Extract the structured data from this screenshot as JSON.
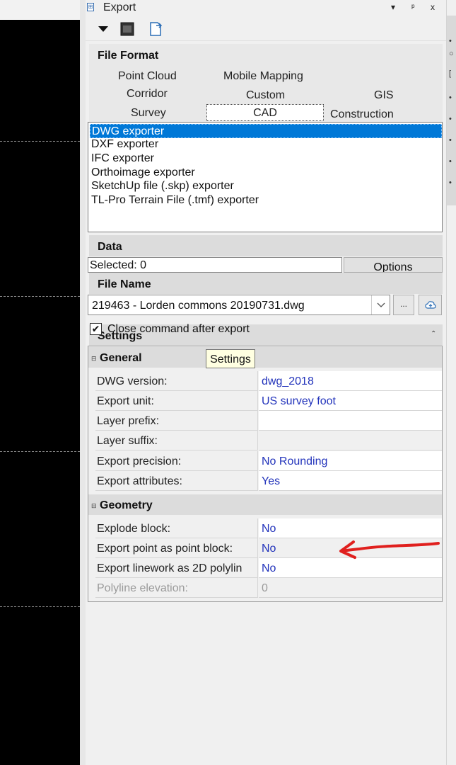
{
  "window": {
    "title": "Export"
  },
  "title_controls": {
    "dropdown": "▾",
    "pin": "ᵖ",
    "close": "x"
  },
  "file_format": {
    "header": "File Format",
    "tabs": [
      "Point Cloud",
      "Mobile Mapping",
      "Corridor",
      "Custom",
      "GIS",
      "Survey",
      "CAD",
      "Construction"
    ],
    "selected_tab": "CAD",
    "exporters": [
      "DWG exporter",
      "DXF exporter",
      "IFC exporter",
      "Orthoimage exporter",
      "SketchUp file (.skp) exporter",
      "TL-Pro Terrain File (.tmf) exporter"
    ],
    "selected_exporter": "DWG exporter"
  },
  "data": {
    "header": "Data",
    "selected_label": "Selected: 0",
    "options_label": "Options"
  },
  "file_name": {
    "header": "File Name",
    "value": "219463 - Lorden commons 20190731.dwg",
    "browse_label": "..."
  },
  "close_after_export": {
    "label": "Close command after export",
    "checked": true
  },
  "settings": {
    "header": "Settings",
    "tooltip": "Settings",
    "categories": [
      {
        "name": "General",
        "rows": [
          {
            "name": "DWG version:",
            "value": "dwg_2018"
          },
          {
            "name": "Export unit:",
            "value": "US survey foot"
          },
          {
            "name": "Layer prefix:",
            "value": ""
          },
          {
            "name": "Layer suffix:",
            "value": ""
          },
          {
            "name": "Export precision:",
            "value": "No Rounding"
          },
          {
            "name": "Export attributes:",
            "value": "Yes"
          }
        ]
      },
      {
        "name": "Geometry",
        "rows": [
          {
            "name": "Explode block:",
            "value": "No"
          },
          {
            "name": "Export point as point block:",
            "value": "No"
          },
          {
            "name": "Export linework as 2D polylin",
            "value": "No"
          },
          {
            "name": "Polyline elevation:",
            "value": "0"
          }
        ]
      }
    ]
  },
  "colors": {
    "selection": "#0078d7",
    "value_text": "#2233bb",
    "annotation_arrow": "#e0201e"
  }
}
